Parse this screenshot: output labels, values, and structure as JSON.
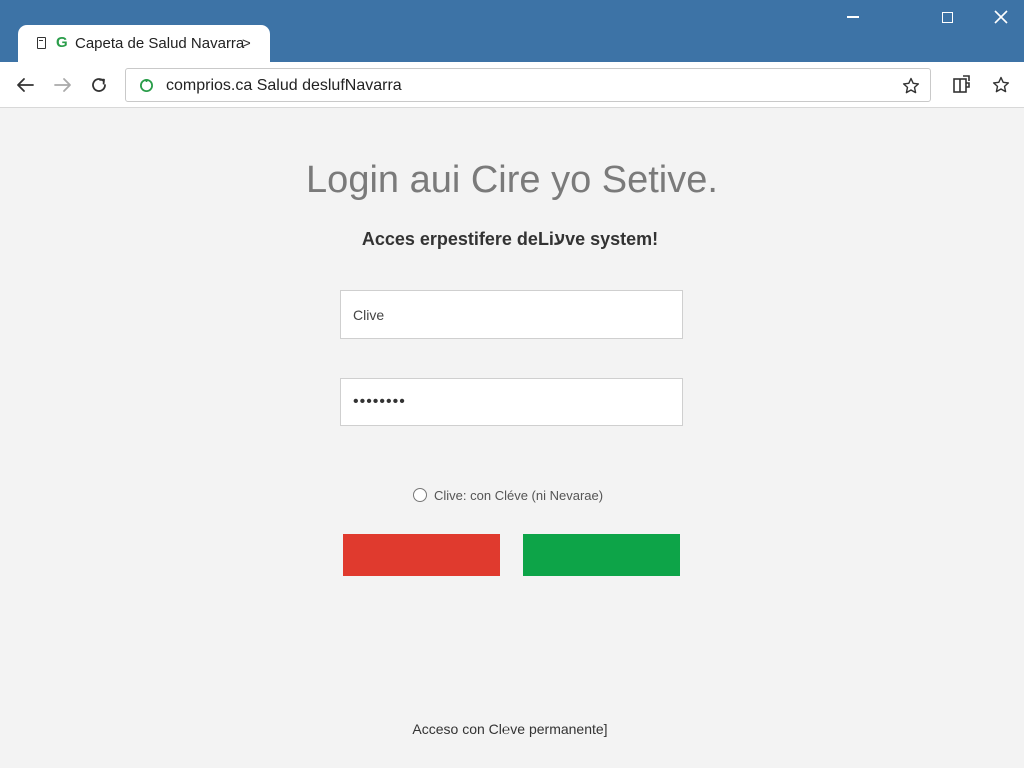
{
  "browser": {
    "tab_title": "Capeta de Salud Navarra",
    "tab_chevron": ">",
    "tab_favicon_letter": "G",
    "url": "comprios.ca Salud deslufNavarra",
    "icons": {
      "tab_page": "page-icon",
      "back": "arrow-left-icon",
      "forward": "arrow-right-icon",
      "reload": "reload-icon",
      "secure": "secure-icon",
      "star": "star-icon",
      "extension": "extension-icon",
      "bookmark": "bookmark-star-icon",
      "minimize": "minimize-icon",
      "maximize": "maximize-icon",
      "close": "close-icon"
    },
    "colors": {
      "titlebar": "#3d73a6",
      "favicon": "#2a9d4a"
    }
  },
  "login": {
    "title": "Login aui Cire yo Setive.",
    "subtitle": "Acces erpestifere deLiעve system!",
    "username_placeholder": "Clive",
    "password_value": "••••••••",
    "radio_label": "Clive: con Cléve (ni Nevarae)",
    "buttons": {
      "red_label": "",
      "green_label": "",
      "red_color": "#e03a2e",
      "green_color": "#0da448"
    },
    "footer_link": "Acceso con Cl℮ve permanente]"
  }
}
